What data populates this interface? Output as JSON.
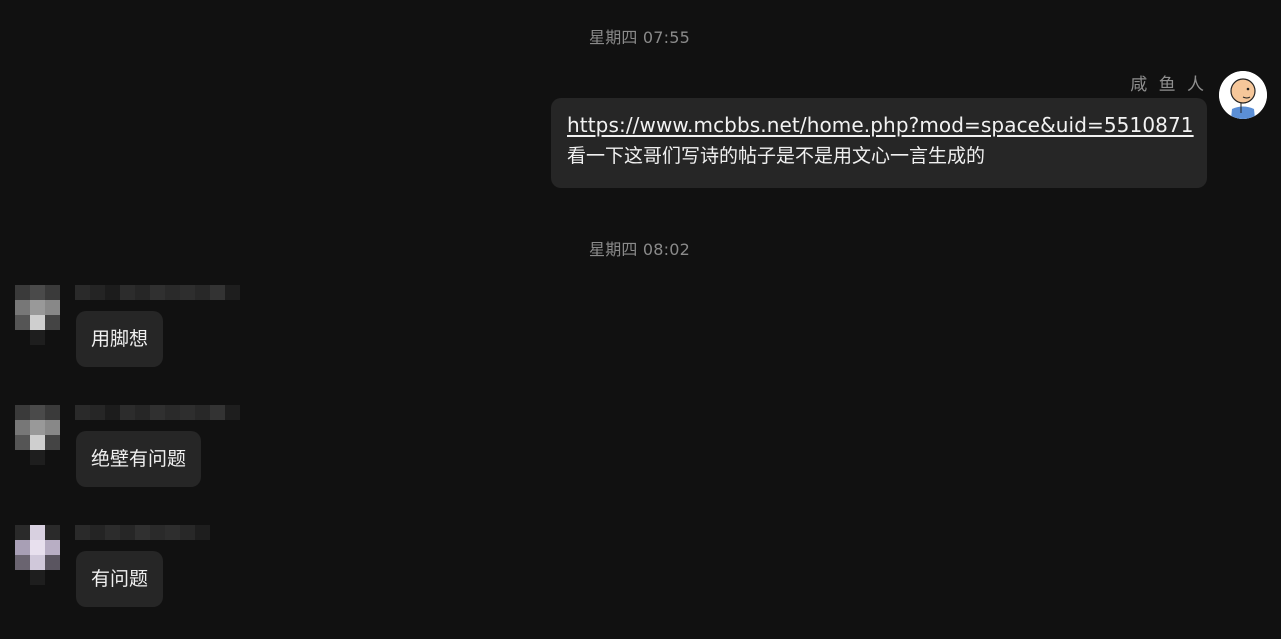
{
  "timestamps": [
    "星期四 07:55",
    "星期四 08:02"
  ],
  "outgoing": {
    "sender": "咸 鱼 人",
    "link": "https://www.mcbbs.net/home.php?mod=space&uid=5510871",
    "text": "看一下这哥们写诗的帖子是不是用文心一言生成的"
  },
  "incoming": [
    {
      "text": "用脚想"
    },
    {
      "text": "绝壁有问题"
    },
    {
      "text": "有问题"
    }
  ],
  "colors": {
    "background": "#111111",
    "bubble": "#262626",
    "timestamp": "#8a8a8a",
    "text": "#f0f0f0"
  }
}
